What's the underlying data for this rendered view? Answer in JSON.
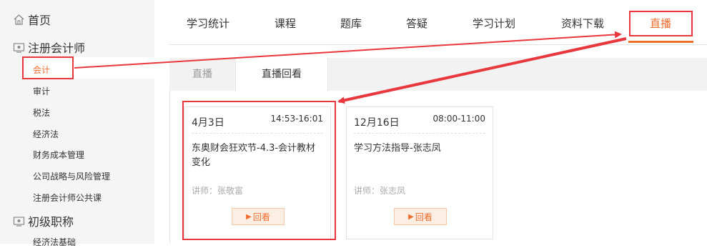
{
  "sidebar": {
    "home": "首页",
    "sections": [
      {
        "label": "注册会计师",
        "items": [
          "会计",
          "审计",
          "税法",
          "经济法",
          "财务成本管理",
          "公司战略与风险管理",
          "注册会计师公共课"
        ]
      },
      {
        "label": "初级职称",
        "items": [
          "经济法基础"
        ]
      }
    ],
    "active_item": "会计"
  },
  "top_tabs": [
    "学习统计",
    "课程",
    "题库",
    "答疑",
    "学习计划",
    "资料下载",
    "直播"
  ],
  "active_top_tab": "直播",
  "sub_tabs": [
    "直播",
    "直播回看"
  ],
  "active_sub_tab": "直播回看",
  "cards": [
    {
      "date": "4月3日",
      "time": "14:53-16:01",
      "title": "东奥财会狂欢节-4.3-会计教材变化",
      "teacher": "讲师：张敬富",
      "action": "回看"
    },
    {
      "date": "12月16日",
      "time": "08:00-11:00",
      "title": "学习方法指导-张志凤",
      "teacher": "讲师：张志凤",
      "action": "回看"
    }
  ],
  "colors": {
    "accent": "#ee6e2e",
    "annotation": "#e8383d",
    "sidebar_bg": "#f5f5f5"
  }
}
